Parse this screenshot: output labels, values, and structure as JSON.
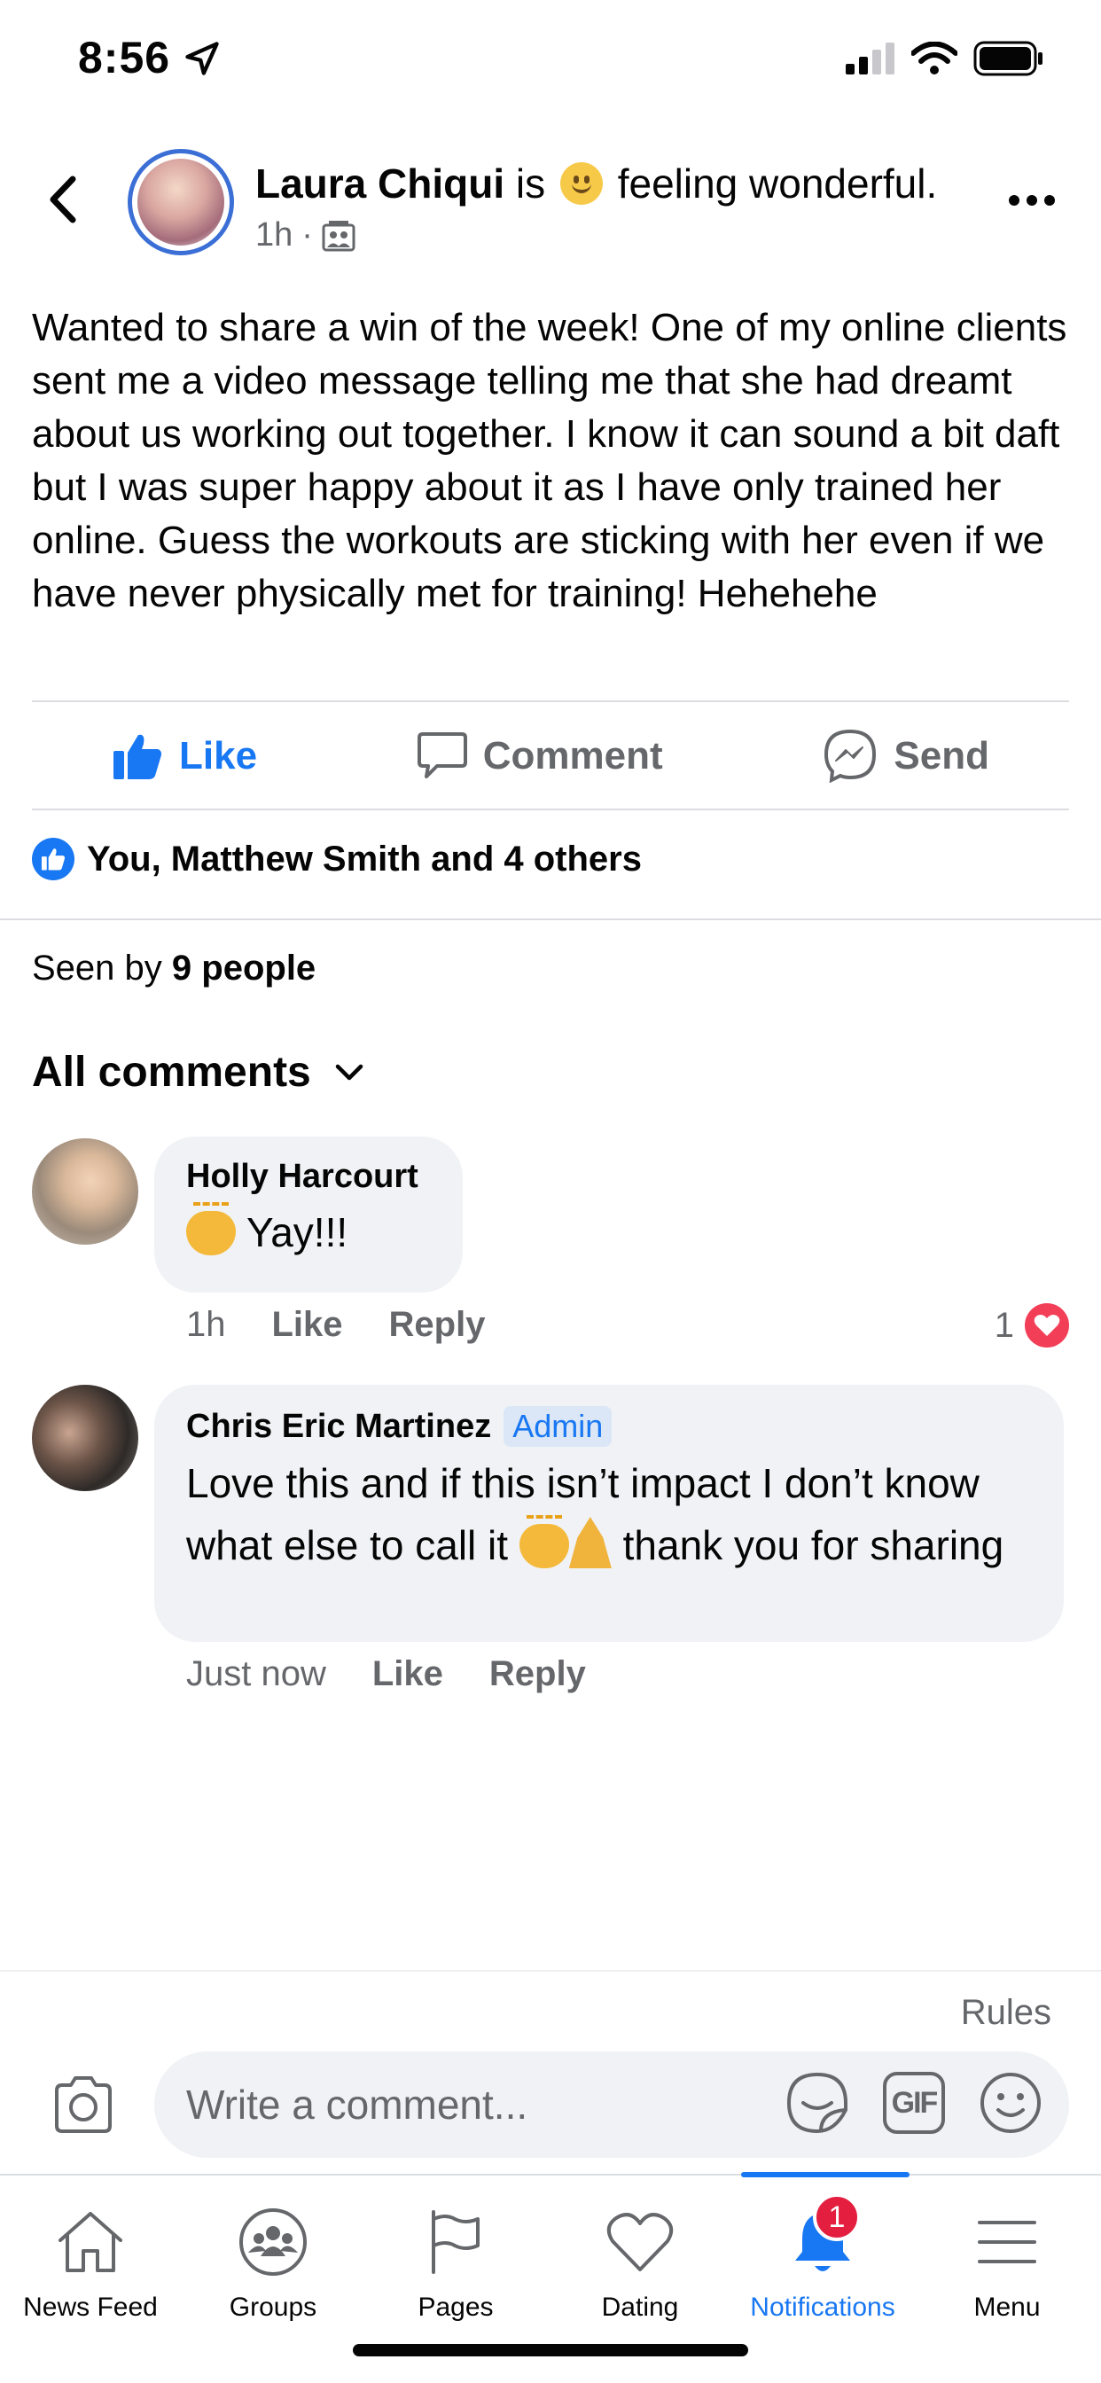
{
  "status_bar": {
    "time": "8:56"
  },
  "post": {
    "author": "Laura Chiqui",
    "is_word": "is",
    "feeling": "feeling wonderful.",
    "time": "1h",
    "separator": "·",
    "body": "Wanted to share a win of the week! One of my online clients sent me a video message telling me that she had dreamt about us working out together. I know it can sound a bit daft but I was super happy about it as I have only trained her online. Guess the workouts are sticking with her even if we have never physically met for training! Hehehehe"
  },
  "actions": {
    "like": "Like",
    "comment": "Comment",
    "send": "Send"
  },
  "likes_text": "You, Matthew Smith and 4 others",
  "seen_by": {
    "prefix": "Seen by",
    "count": "9 people"
  },
  "comments_header": "All comments",
  "comments": [
    {
      "name": "Holly Harcourt",
      "text": "Yay!!!",
      "time": "1h",
      "like": "Like",
      "reply": "Reply",
      "reaction_count": "1"
    },
    {
      "name": "Chris Eric Martinez",
      "badge": "Admin",
      "text_before": "Love this and if this isn’t impact I don’t know what else to call it",
      "text_after": "thank you for sharing",
      "time": "Just now",
      "like": "Like",
      "reply": "Reply"
    }
  ],
  "composer": {
    "rules": "Rules",
    "placeholder": "Write a comment...",
    "gif": "GIF"
  },
  "tabbar": {
    "tabs": [
      {
        "label": "News Feed"
      },
      {
        "label": "Groups"
      },
      {
        "label": "Pages"
      },
      {
        "label": "Dating"
      },
      {
        "label": "Notifications",
        "badge": "1"
      },
      {
        "label": "Menu"
      }
    ],
    "active_index": 4
  },
  "colors": {
    "accent": "#1877f2",
    "text_secondary": "#65676b",
    "bubble": "#f0f2f5",
    "heart": "#f33e58",
    "badge_red": "#e41e3f"
  }
}
